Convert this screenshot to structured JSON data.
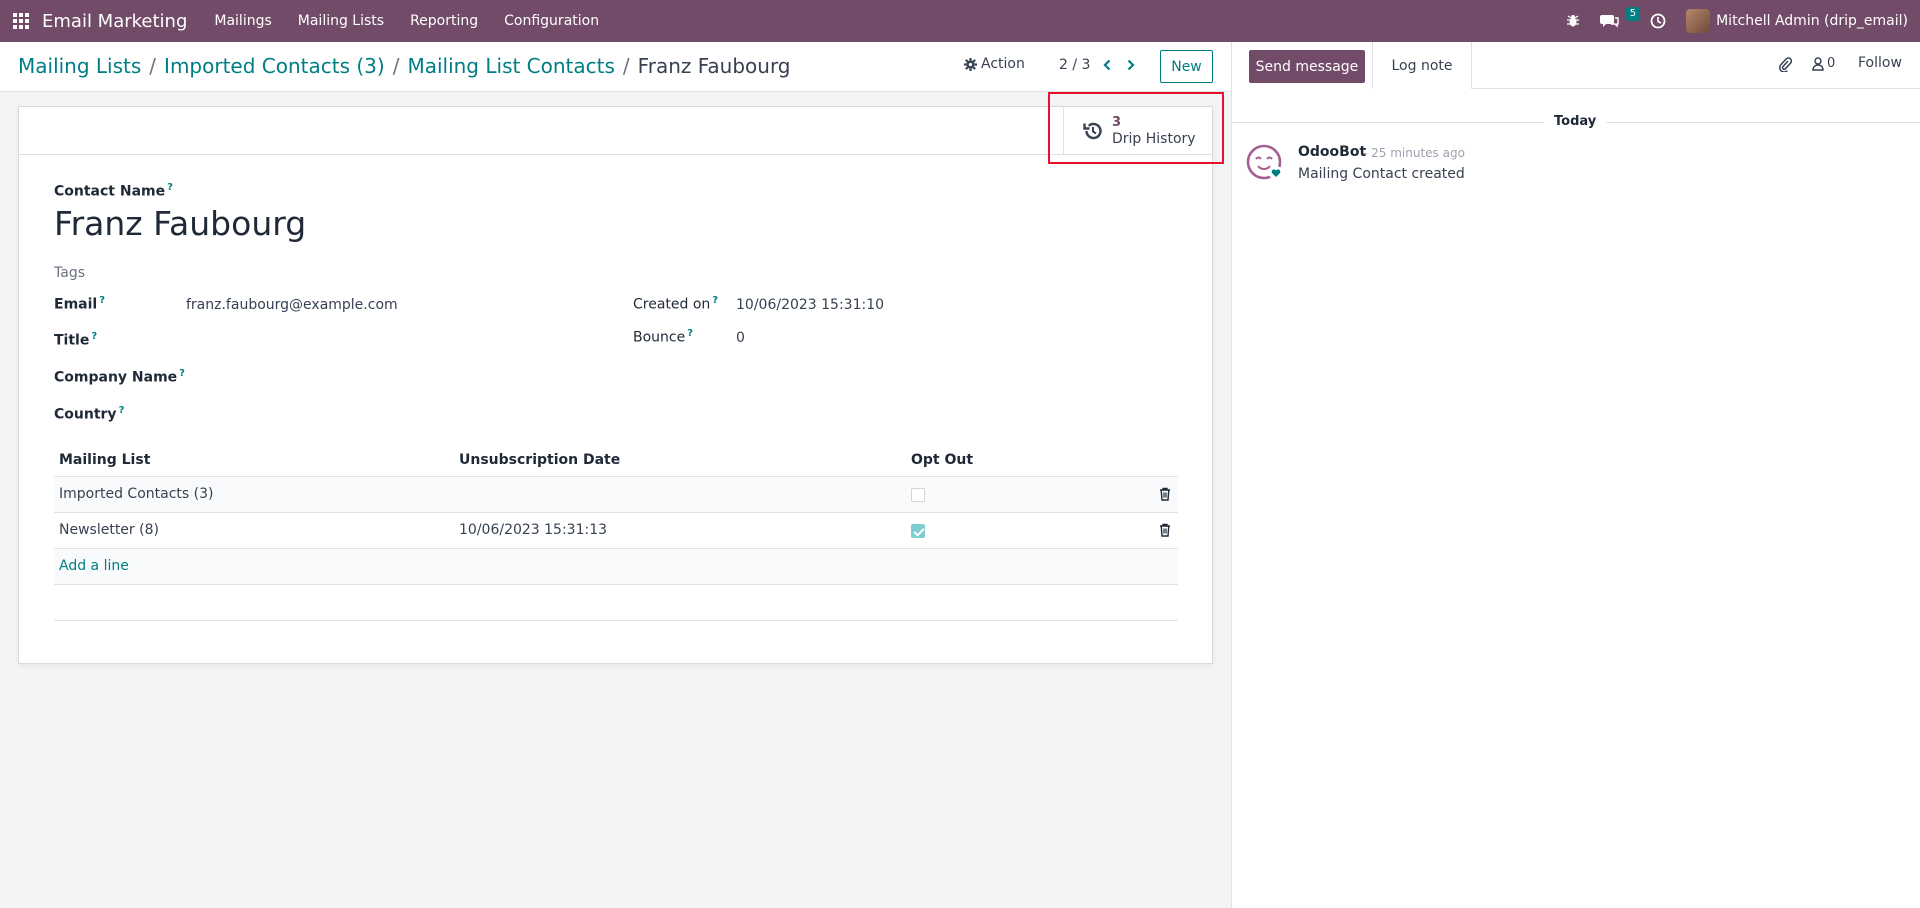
{
  "navbar": {
    "brand": "Email Marketing",
    "menu": [
      "Mailings",
      "Mailing Lists",
      "Reporting",
      "Configuration"
    ],
    "messages_badge": "5",
    "user": "Mitchell Admin (drip_email)"
  },
  "control": {
    "breadcrumb": [
      "Mailing Lists",
      "Imported Contacts (3)",
      "Mailing List Contacts"
    ],
    "current": "Franz Faubourg",
    "action_label": "Action",
    "pager": "2 / 3",
    "new_label": "New"
  },
  "form": {
    "stat_button": {
      "value": "3",
      "label": "Drip History"
    },
    "contact_name_label": "Contact Name",
    "contact_name": "Franz Faubourg",
    "tags_placeholder": "Tags",
    "email_label": "Email",
    "email": "franz.faubourg@example.com",
    "title_label": "Title",
    "company_label": "Company Name",
    "country_label": "Country",
    "created_on_label": "Created on",
    "created_on": "10/06/2023 15:31:10",
    "bounce_label": "Bounce",
    "bounce": "0",
    "table": {
      "headers": [
        "Mailing List",
        "Unsubscription Date",
        "Opt Out"
      ],
      "rows": [
        {
          "list": "Imported Contacts (3)",
          "date": "",
          "opt_out": false
        },
        {
          "list": "Newsletter (8)",
          "date": "10/06/2023 15:31:13",
          "opt_out": true
        }
      ],
      "add_line": "Add a line"
    }
  },
  "chatter": {
    "send_message": "Send message",
    "log_note": "Log note",
    "followers_count": "0",
    "follow": "Follow",
    "today": "Today",
    "message": {
      "author": "OdooBot",
      "date": "- 25 minutes ago",
      "body": "Mailing Contact created"
    }
  },
  "colors": {
    "brand": "#714b67",
    "accent": "#017e84",
    "highlight": "#e3142a"
  }
}
